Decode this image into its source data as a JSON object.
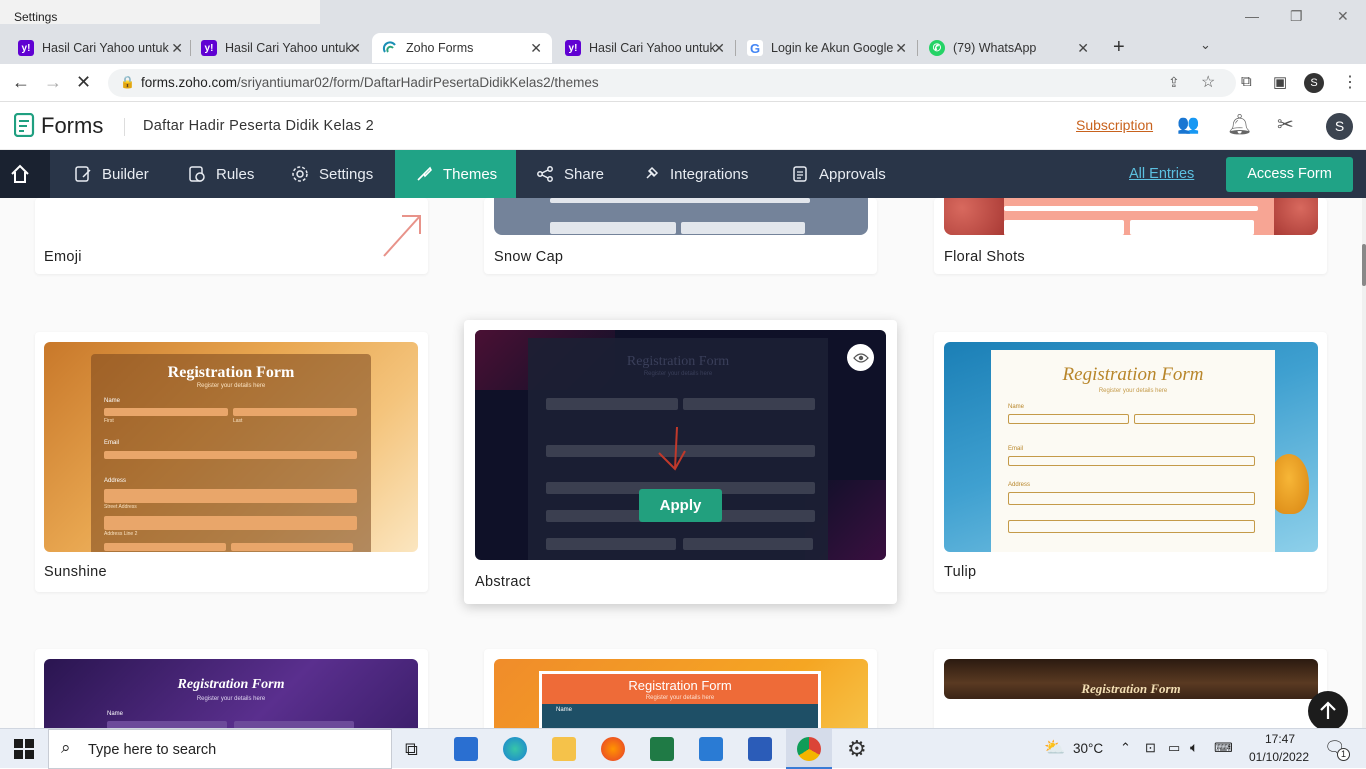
{
  "window": {
    "title": "Settings"
  },
  "tabs": [
    {
      "label": "Hasil Cari Yahoo untuk",
      "favicon": "yahoo-icon"
    },
    {
      "label": "Hasil Cari Yahoo untuk",
      "favicon": "yahoo-icon"
    },
    {
      "label": "Zoho Forms",
      "favicon": "zoho-icon"
    },
    {
      "label": "Hasil Cari Yahoo untuk",
      "favicon": "yahoo-icon"
    },
    {
      "label": "Login ke Akun Google",
      "favicon": "google-icon"
    },
    {
      "label": "(79) WhatsApp",
      "favicon": "whatsapp-icon"
    }
  ],
  "address": {
    "host": "forms.zoho.com",
    "path": "/sriyantiumar02/form/DaftarHadirPesertaDidikKelas2/themes"
  },
  "app": {
    "logo_text": "Forms",
    "form_title": "Daftar Hadir Peserta Didik Kelas 2",
    "subscription": "Subscription",
    "avatar": "S"
  },
  "nav": {
    "items": [
      "Builder",
      "Rules",
      "Settings",
      "Themes",
      "Share",
      "Integrations",
      "Approvals"
    ],
    "all_entries": "All Entries",
    "access_form": "Access Form"
  },
  "themes": {
    "row1": [
      "Emoji",
      "Snow Cap",
      "Floral Shots"
    ],
    "row2": [
      "Sunshine",
      "Abstract",
      "Tulip"
    ],
    "apply": "Apply",
    "thumb": {
      "title": "Registration Form",
      "subtitle": "Register your details here",
      "name": "Name",
      "first": "First",
      "last": "Last",
      "email": "Email",
      "address": "Address",
      "street": "Street Address",
      "line2": "Address Line 2"
    }
  },
  "taskbar": {
    "search": "Type here to search",
    "temp": "30°C",
    "time": "17:47",
    "date": "01/10/2022",
    "notifications": "1"
  },
  "colors": {
    "navbar": "#293548",
    "accent": "#20a386",
    "subscription": "#c8621d"
  }
}
